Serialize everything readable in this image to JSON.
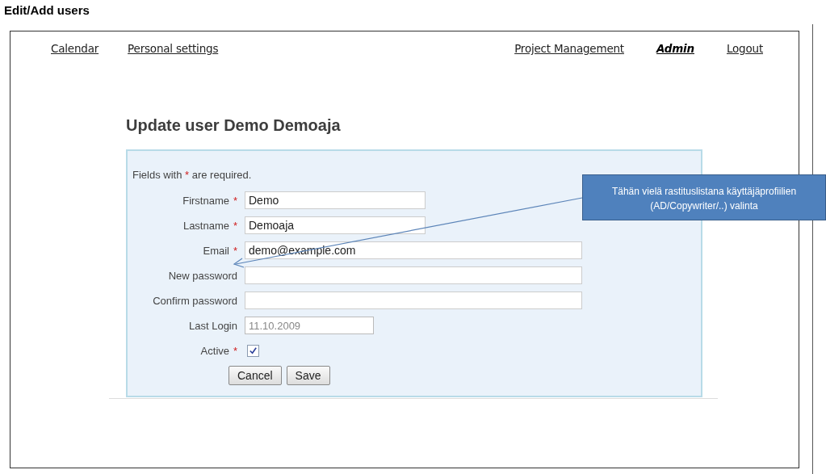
{
  "page_title": "Edit/Add users",
  "nav": {
    "left": [
      {
        "label": "Calendar",
        "selected": false
      },
      {
        "label": "Personal settings",
        "selected": false
      }
    ],
    "right": [
      {
        "label": "Project Management",
        "selected": false
      },
      {
        "label": "Admin",
        "selected": true
      },
      {
        "label": "Logout",
        "selected": false
      }
    ]
  },
  "heading": "Update user Demo Demoaja",
  "form": {
    "note": {
      "before": "Fields with",
      "mark": "*",
      "after": "are required."
    },
    "fields": [
      {
        "label": "Firstname",
        "required_mark": "*",
        "kind": "short",
        "value": "Demo"
      },
      {
        "label": "Lastname",
        "required_mark": "*",
        "kind": "short",
        "value": "Demoaja"
      },
      {
        "label": "Email",
        "required_mark": "*",
        "kind": "long",
        "value": "demo@example.com"
      },
      {
        "label": "New password",
        "kind": "long"
      },
      {
        "label": "Confirm password",
        "kind": "long"
      },
      {
        "label": "Last Login",
        "kind": "readonly",
        "value": "11.10.2009"
      },
      {
        "label": "Active",
        "required_mark": "*",
        "kind": "checkbox",
        "checked": true
      }
    ],
    "buttons": [
      "Cancel",
      "Save"
    ]
  },
  "callout": "Tähän vielä rastituslistana käyttäjäprofiilien (AD/Copywriter/..) valinta"
}
